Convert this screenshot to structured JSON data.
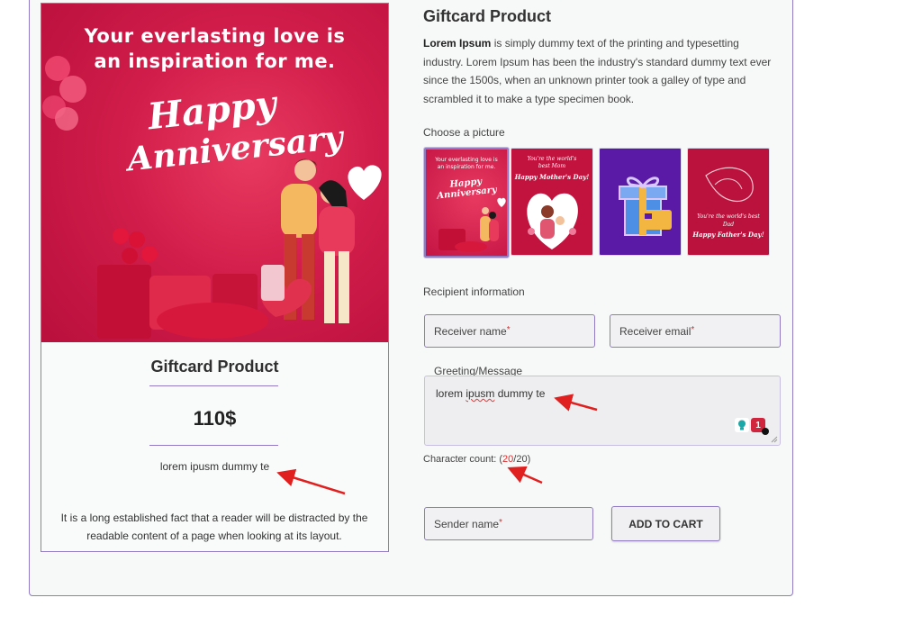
{
  "left_card": {
    "hero_line1": "Your everlasting love is",
    "hero_line2": "an inspiration for me.",
    "hero_happy": "Happy",
    "hero_anniversary": "Anniversary",
    "title": "Giftcard Product",
    "price": "110$",
    "message": "lorem ipusm dummy te",
    "description": "It is a long established fact that a reader will be distracted by the readable content of a page when looking at its layout."
  },
  "product": {
    "title": "Giftcard Product",
    "desc_bold": "Lorem Ipsum",
    "desc_rest": " is simply dummy text of the printing and typesetting industry. Lorem Ipsum has been the industry's standard dummy text ever since the 1500s, when an unknown printer took a galley of type and scrambled it to make a type specimen book."
  },
  "picture_section": {
    "label": "Choose a picture",
    "thumbs": [
      {
        "line1": "Your everlasting love is",
        "line2": "an inspiration for me.",
        "script": "Happy Anniversary",
        "selected": true
      },
      {
        "line1": "You're the world's",
        "line2": "best Mom",
        "script": "Happy Mother's Day!"
      },
      {
        "line1": "",
        "line2": "",
        "script": ""
      },
      {
        "line1": "You're the world's best",
        "line2": "Dad",
        "script": "Happy Father's Day!"
      }
    ]
  },
  "recipient": {
    "label": "Recipient information",
    "name_placeholder": "Receiver name",
    "email_placeholder": "Receiver email"
  },
  "greeting": {
    "label": "Greeting/Message",
    "value_word1": "lorem",
    "value_word2": "ipusm",
    "value_rest": "dummy te",
    "badge_count": "1"
  },
  "char_count": {
    "prefix": "Character count: (",
    "current": "20",
    "suffix": "/20)"
  },
  "sender": {
    "name_placeholder": "Sender name"
  },
  "cart_button": "ADD TO CART",
  "colors": {
    "accent": "#8f7ac3",
    "hero_red": "#d11d4a",
    "required_red": "#d32f2f",
    "annotation_red": "#e01f1f"
  }
}
